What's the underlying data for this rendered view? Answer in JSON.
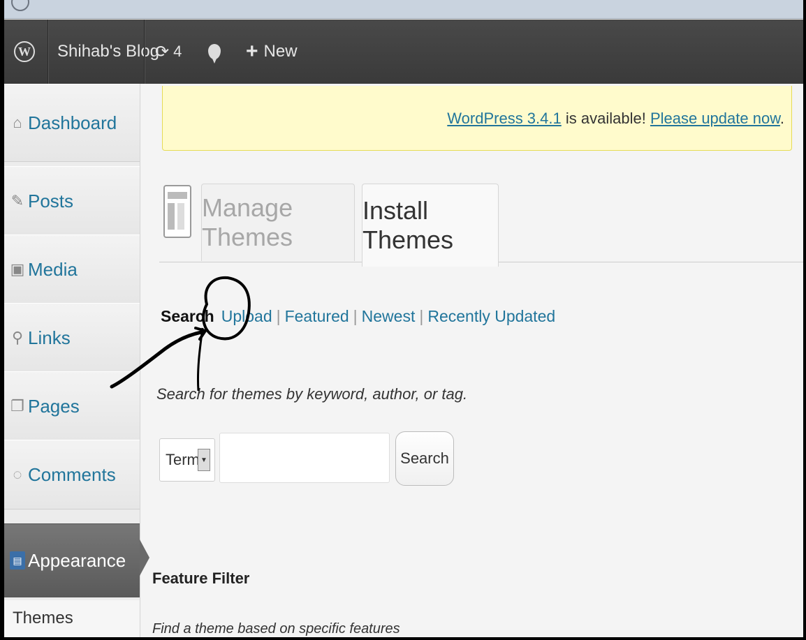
{
  "admin_bar": {
    "site_name": "Shihab's Blog",
    "updates_count": "4",
    "new_label": "New"
  },
  "sidebar": {
    "items": [
      {
        "label": "Dashboard",
        "icon": "dashboard-icon"
      },
      {
        "label": "Posts",
        "icon": "pushpin-icon"
      },
      {
        "label": "Media",
        "icon": "media-icon"
      },
      {
        "label": "Links",
        "icon": "link-icon"
      },
      {
        "label": "Pages",
        "icon": "pages-icon"
      },
      {
        "label": "Comments",
        "icon": "comment-icon"
      },
      {
        "label": "Appearance",
        "icon": "appearance-icon"
      }
    ],
    "submenu_current": "Themes"
  },
  "update_nag": {
    "version_link": "WordPress 3.4.1",
    "middle_text": " is available! ",
    "update_link": "Please update now",
    "end": "."
  },
  "tabs": {
    "manage": "Manage Themes",
    "install": "Install Themes"
  },
  "subnav": {
    "current": "Search",
    "links": [
      "Upload",
      "Featured",
      "Newest",
      "Recently Updated"
    ],
    "separator": "|"
  },
  "search": {
    "description": "Search for themes by keyword, author, or tag.",
    "type_value": "Term",
    "button_label": "Search"
  },
  "feature_filter": {
    "title": "Feature Filter",
    "description": "Find a theme based on specific features"
  },
  "colors": {
    "admin_bar": "#464646",
    "link": "#21759b",
    "nag_bg": "#fffbcc",
    "current_menu": "#666666"
  }
}
